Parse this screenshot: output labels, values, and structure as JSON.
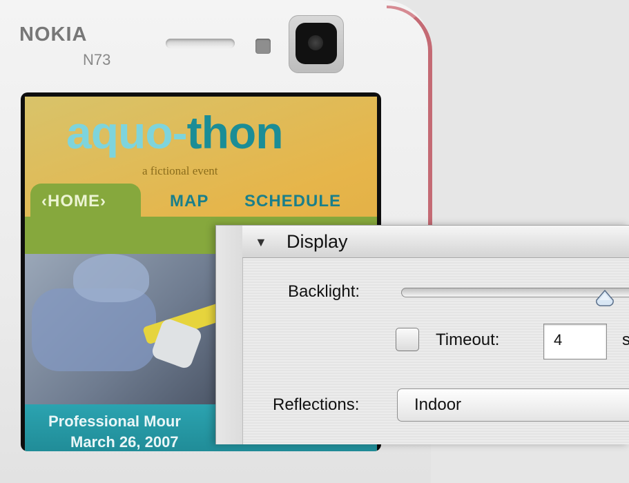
{
  "phone": {
    "brand": "NOKIA",
    "model": "N73"
  },
  "website": {
    "title_part1": "aquo-",
    "title_part2": "thon",
    "tagline": "a fictional event",
    "nav": {
      "home": "‹HOME›",
      "map": "MAP",
      "schedule": "SCHEDULE"
    },
    "caption_line1": "Professional Mour",
    "caption_line2": "March 26, 2007"
  },
  "panel": {
    "section_title": "Display",
    "backlight_label": "Backlight:",
    "backlight_level": 0.82,
    "timeout_checked": false,
    "timeout_label": "Timeout:",
    "timeout_value": "4",
    "timeout_unit": "s",
    "reflections_label": "Reflections:",
    "reflections_value": "Indoor"
  },
  "colors": {
    "site_teal": "#1a7f8a",
    "site_green": "#86a83d",
    "site_title_light": "#7ed4dc",
    "phone_rim": "#c46a74"
  }
}
